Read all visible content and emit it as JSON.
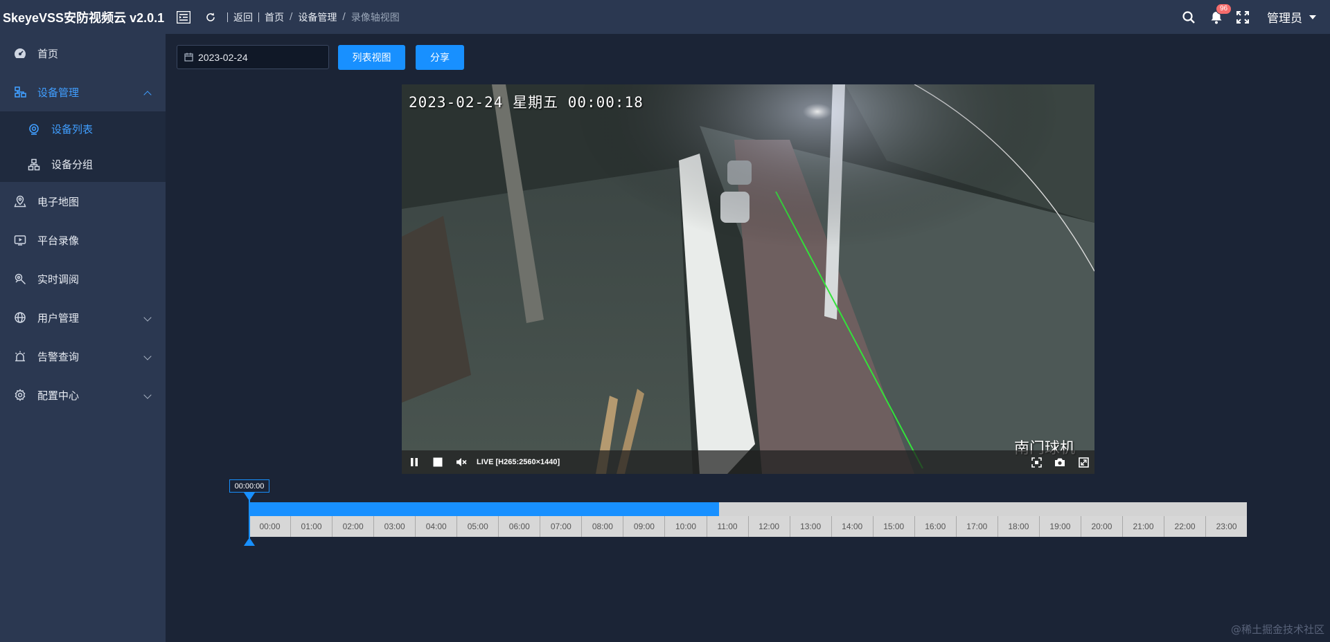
{
  "header": {
    "app_title": "SkeyeVSS安防视频云 v2.0.1",
    "back_label": "返回",
    "breadcrumbs": [
      "首页",
      "设备管理",
      "录像轴视图"
    ],
    "notification_count": "96",
    "user_name": "管理员"
  },
  "sidebar": {
    "items": [
      {
        "label": "首页",
        "icon": "dashboard-icon"
      },
      {
        "label": "设备管理",
        "icon": "device-tree-icon",
        "expanded": true
      },
      {
        "label": "电子地图",
        "icon": "map-pin-icon"
      },
      {
        "label": "平台录像",
        "icon": "video-record-icon"
      },
      {
        "label": "实时调阅",
        "icon": "live-view-icon"
      },
      {
        "label": "用户管理",
        "icon": "globe-icon"
      },
      {
        "label": "告警查询",
        "icon": "alarm-icon"
      },
      {
        "label": "配置中心",
        "icon": "settings-icon"
      }
    ],
    "submenu": [
      {
        "label": "设备列表",
        "icon": "camera-icon",
        "active": true
      },
      {
        "label": "设备分组",
        "icon": "group-tree-icon"
      }
    ]
  },
  "toolbar": {
    "date_value": "2023-02-24",
    "list_view_label": "列表视图",
    "share_label": "分享"
  },
  "video": {
    "osd_time": "2023-02-24  星期五  00:00:18",
    "camera_name": "南门球机",
    "live_info": "LIVE [H265:2560×1440]"
  },
  "timeline": {
    "current_time": "00:00:00",
    "recorded_fraction": 0.4706,
    "hours": [
      "00:00",
      "01:00",
      "02:00",
      "03:00",
      "04:00",
      "05:00",
      "06:00",
      "07:00",
      "08:00",
      "09:00",
      "10:00",
      "11:00",
      "12:00",
      "13:00",
      "14:00",
      "15:00",
      "16:00",
      "17:00",
      "18:00",
      "19:00",
      "20:00",
      "21:00",
      "22:00",
      "23:00"
    ]
  },
  "watermark": "@稀土掘金技术社区",
  "colors": {
    "accent": "#1890ff",
    "header_bg": "#2b3851",
    "page_bg": "#1b2436",
    "badge": "#f56c6c"
  }
}
